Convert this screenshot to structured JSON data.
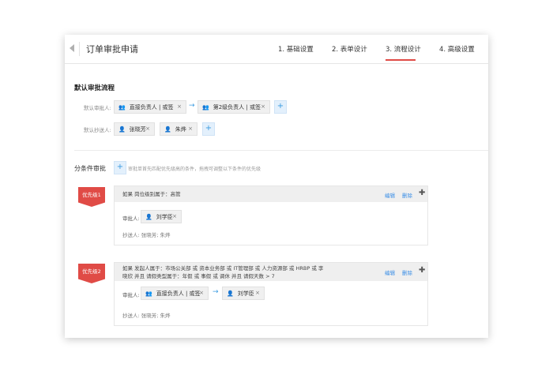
{
  "header": {
    "title": "订单审批申请",
    "steps": [
      "1. 基础设置",
      "2. 表单设计",
      "3. 流程设计",
      "4. 高级设置"
    ],
    "active_step": 2
  },
  "default_flow": {
    "title": "默认审批流程",
    "approver_label": "默认审批人:",
    "approvers": [
      "直接负责人 | 或签",
      "第2级负责人 | 或签"
    ],
    "cc_label": "默认抄送人:",
    "cc": [
      "张晓芳",
      "朱烨"
    ]
  },
  "conditional": {
    "title": "分条件审批",
    "hint": "审批单首先匹配优先级高的条件，拖拽可调整以下条件的优先级",
    "rules": [
      {
        "priority": "优先级1",
        "condition_line1": "如果  岗位级别属于：高管",
        "condition_line2": "",
        "edit": "编辑",
        "delete": "删除",
        "approver_label": "审批人:",
        "approvers": [
          "刘学臣"
        ],
        "cc_text": "抄送人: 张晓芳; 朱烨"
      },
      {
        "priority": "优先级2",
        "condition_line1": "如果  发起人属于：市场公关部 或 资本业务部 或 IT管理部 或 人力资源部 或 HRBP 或 李",
        "condition_line2": "晓欣 并且 请假类型属于：年假 或 事假 或 调休 并且 请假天数 > 7",
        "edit": "编辑",
        "delete": "删除",
        "approver_label": "审批人:",
        "approvers": [
          "直接负责人 | 或签",
          "刘学臣"
        ],
        "cc_text": "抄送人: 张晓芳; 朱烨"
      }
    ]
  },
  "colors": {
    "accent": "#e04b46",
    "link": "#3a8ee6"
  },
  "icons": {
    "close": "×",
    "add": "+",
    "arrow": "→",
    "more": "✚"
  }
}
